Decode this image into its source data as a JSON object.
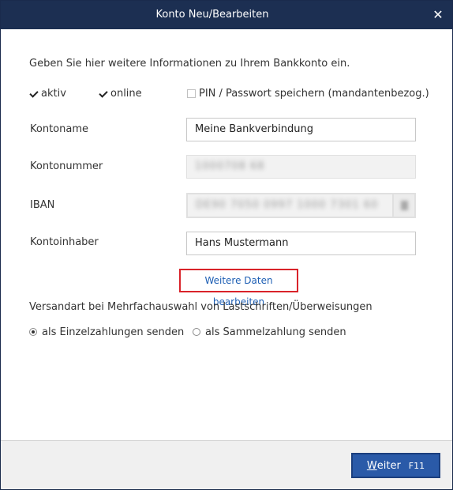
{
  "window": {
    "title": "Konto Neu/Bearbeiten",
    "close_symbol": "✕"
  },
  "intro_text": "Geben Sie hier weitere Informationen zu Ihrem Bankkonto ein.",
  "checkboxes": {
    "aktiv": {
      "label": "aktiv",
      "checked": true
    },
    "online": {
      "label": "online",
      "checked": true
    },
    "pin": {
      "label": "PIN / Passwort speichern (mandantenbezog.)",
      "checked": false
    }
  },
  "fields": {
    "kontoname": {
      "label": "Kontoname",
      "value": "Meine Bankverbindung"
    },
    "kontonummer": {
      "label": "Kontonummer",
      "value": "1000708 68"
    },
    "iban": {
      "label": "IBAN",
      "value": "DE90 7050 0997 1000 7301 60"
    },
    "kontoinhaber": {
      "label": "Kontoinhaber",
      "value": "Hans Mustermann"
    }
  },
  "link_weitere_daten": "Weitere Daten bearbeiten",
  "versand": {
    "label": "Versandart bei Mehrfachauswahl von Lastschriften/Überweisungen",
    "options": [
      {
        "label": "als Einzelzahlungen senden",
        "selected": true
      },
      {
        "label": "als Sammelzahlung senden",
        "selected": false
      }
    ]
  },
  "footer": {
    "weiter_first": "W",
    "weiter_rest": "eiter",
    "weiter_key": "F11"
  },
  "colors": {
    "titlebar": "#1c2f52",
    "accent": "#2a5aa8",
    "link": "#1e5fb4",
    "highlight": "#d9232a"
  }
}
